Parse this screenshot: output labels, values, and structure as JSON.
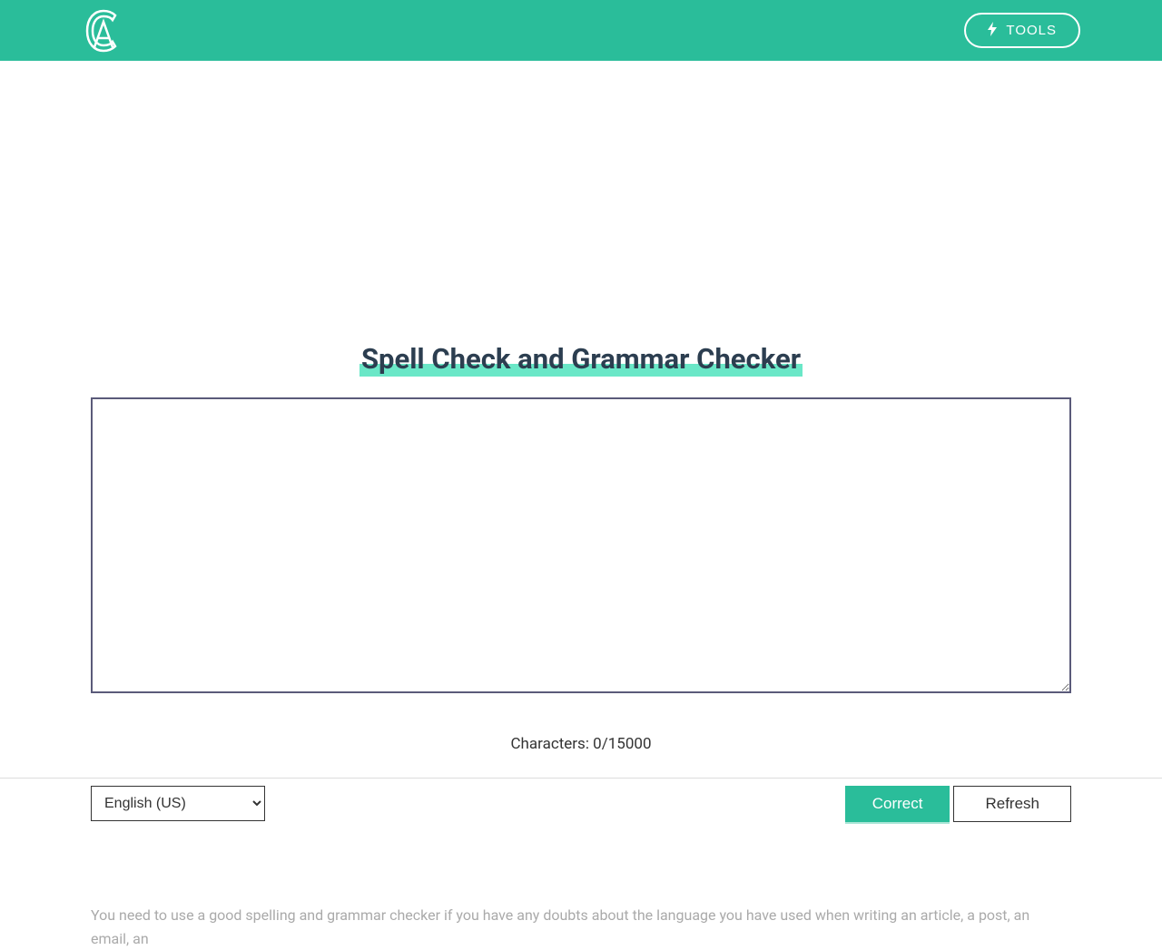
{
  "header": {
    "tools_label": "TOOLS"
  },
  "page": {
    "title": "Spell Check and Grammar Checker"
  },
  "editor": {
    "text_value": "",
    "char_label": "Characters: 0/15000",
    "char_current": 0,
    "char_max": 15000
  },
  "language": {
    "selected": "English (US)",
    "options": [
      "English (US)"
    ]
  },
  "buttons": {
    "correct_label": "Correct",
    "refresh_label": "Refresh"
  },
  "description": {
    "text": "You need to use a good spelling and grammar checker if you have any doubts about the language you have used when writing an article, a post, an email, an"
  },
  "colors": {
    "accent": "#2abd9a",
    "highlight": "#6ae7c7",
    "text_dark": "#2c3e50",
    "text_muted": "#aaaaaa"
  }
}
